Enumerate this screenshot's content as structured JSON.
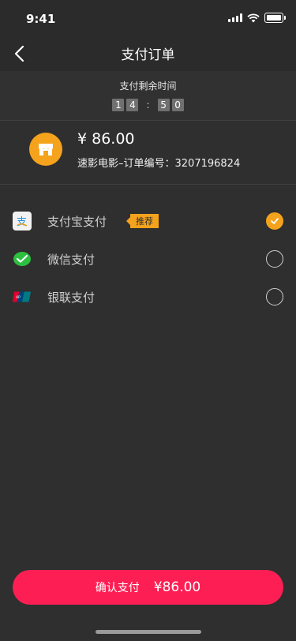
{
  "status": {
    "time": "9:41"
  },
  "nav": {
    "title": "支付订单"
  },
  "timer": {
    "label": "支付剩余时间",
    "digits": [
      "1",
      "4",
      "5",
      "0"
    ],
    "separator": ":"
  },
  "order": {
    "amount": "¥ 86.00",
    "description": "速影电影–订单编号：3207196824",
    "icon": "shop-icon"
  },
  "payment_methods": [
    {
      "label": "支付宝支付",
      "icon": "alipay-icon",
      "badge": "推荐",
      "selected": true
    },
    {
      "label": "微信支付",
      "icon": "wechat-pay-icon",
      "badge": "",
      "selected": false
    },
    {
      "label": "银联支付",
      "icon": "unionpay-icon",
      "badge": "",
      "selected": false
    }
  ],
  "confirm": {
    "label": "确认支付",
    "amount": "¥86.00"
  },
  "colors": {
    "background": "#2f2f2f",
    "accent_orange": "#f5a21c",
    "confirm_red": "#fd1f54"
  }
}
